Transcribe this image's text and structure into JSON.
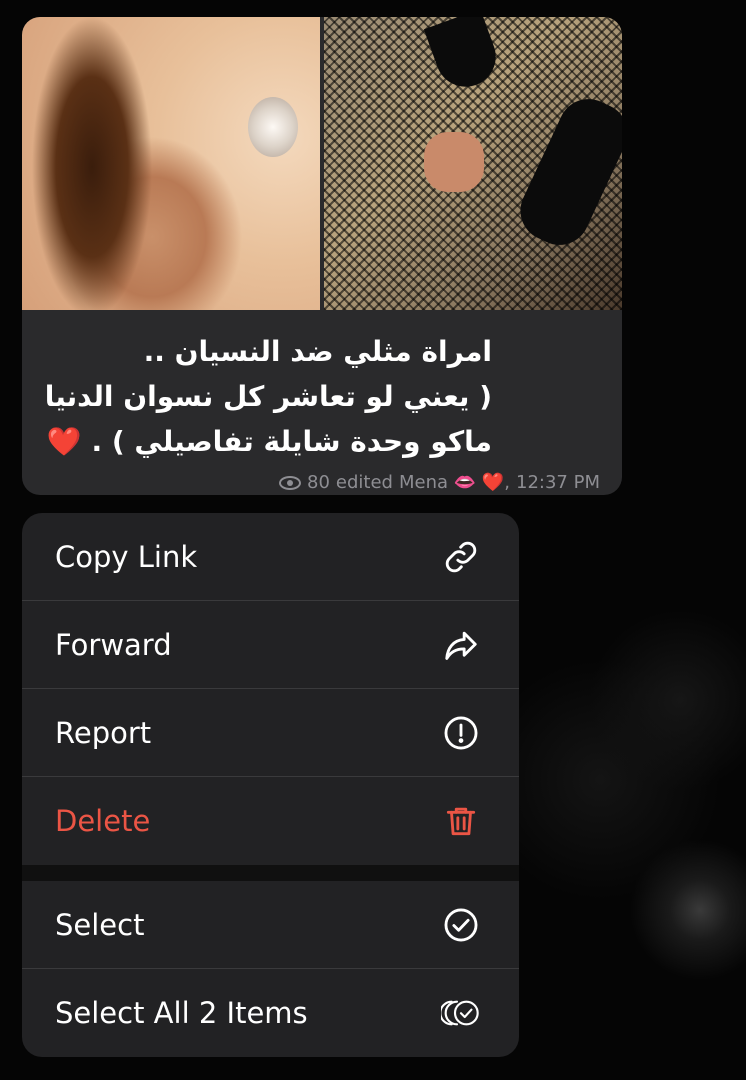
{
  "message": {
    "caption_lines": [
      "امراة مثلي ضد النسيان ..",
      "( يعني لو تعاشر كل نسوان الدنيا",
      "ماكو وحدة شايلة تفاصيلي ) . ❤️"
    ],
    "views": "80",
    "edited": "edited",
    "author": "Mena 👄 ❤️,",
    "time": "12:37 PM",
    "photos": [
      "photo-1",
      "photo-2"
    ]
  },
  "menu": {
    "items": [
      {
        "label": "Copy Link",
        "icon": "link-icon"
      },
      {
        "label": "Forward",
        "icon": "forward-arrow-icon"
      },
      {
        "label": "Report",
        "icon": "exclamation-circle-icon"
      },
      {
        "label": "Delete",
        "icon": "trash-icon",
        "color": "#eb5545"
      }
    ],
    "selection_items": [
      {
        "label": "Select",
        "icon": "checkmark-circle-icon"
      },
      {
        "label": "Select All 2 Items",
        "icon": "multi-checkmark-circle-icon"
      }
    ]
  },
  "colors": {
    "bubble_bg": "#2a2a2c",
    "menu_bg": "#222224",
    "danger": "#eb5545",
    "meta_text": "#8e8e93"
  }
}
